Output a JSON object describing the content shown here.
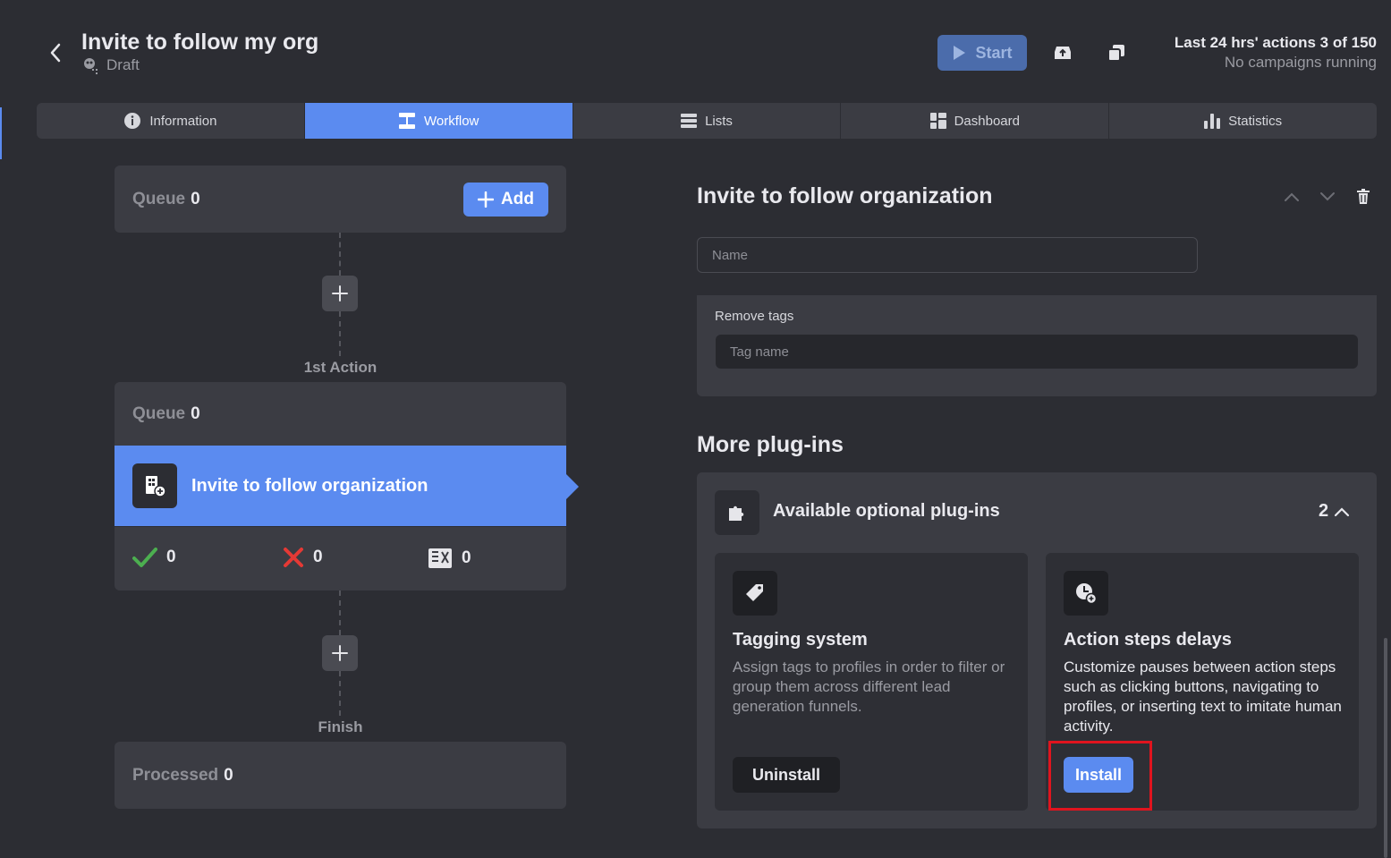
{
  "header": {
    "title": "Invite to follow my org",
    "status": "Draft",
    "start_label": "Start",
    "stats_line1": "Last 24 hrs' actions 3 of 150",
    "stats_line2": "No campaigns running"
  },
  "tabs": [
    {
      "label": "Information",
      "icon": "info-icon",
      "active": false
    },
    {
      "label": "Workflow",
      "icon": "workflow-icon",
      "active": true
    },
    {
      "label": "Lists",
      "icon": "list-icon",
      "active": false
    },
    {
      "label": "Dashboard",
      "icon": "dashboard-icon",
      "active": false
    },
    {
      "label": "Statistics",
      "icon": "bar-chart-icon",
      "active": false
    }
  ],
  "workflow": {
    "start_queue_label": "Queue",
    "start_queue_value": "0",
    "add_label": "Add",
    "step1_label": "1st Action",
    "action_queue_label": "Queue",
    "action_queue_value": "0",
    "action_name": "Invite to follow organization",
    "success_count": "0",
    "failed_count": "0",
    "skipped_count": "0",
    "finish_label": "Finish",
    "processed_label": "Processed",
    "processed_value": "0"
  },
  "panel": {
    "title": "Invite to follow organization",
    "name_placeholder": "Name",
    "remove_tags_label": "Remove tags",
    "tag_placeholder": "Tag name",
    "more_title": "More plug-ins",
    "available_title": "Available optional plug-ins",
    "available_count": "2",
    "plugins": [
      {
        "name": "Tagging system",
        "description": "Assign tags to profiles in order to filter or group them across different lead generation funnels.",
        "button": "Uninstall",
        "icon": "tag-icon"
      },
      {
        "name": "Action steps delays",
        "description": "Customize pauses between action steps such as clicking buttons, navigating to profiles, or inserting text to imitate human activity.",
        "button": "Install",
        "icon": "clock-icon"
      }
    ]
  },
  "colors": {
    "background": "#2c2d33",
    "card": "#3b3c43",
    "accent": "#5b8bf0",
    "success": "#4caf50",
    "danger": "#e53935",
    "highlight": "#e0141e"
  }
}
